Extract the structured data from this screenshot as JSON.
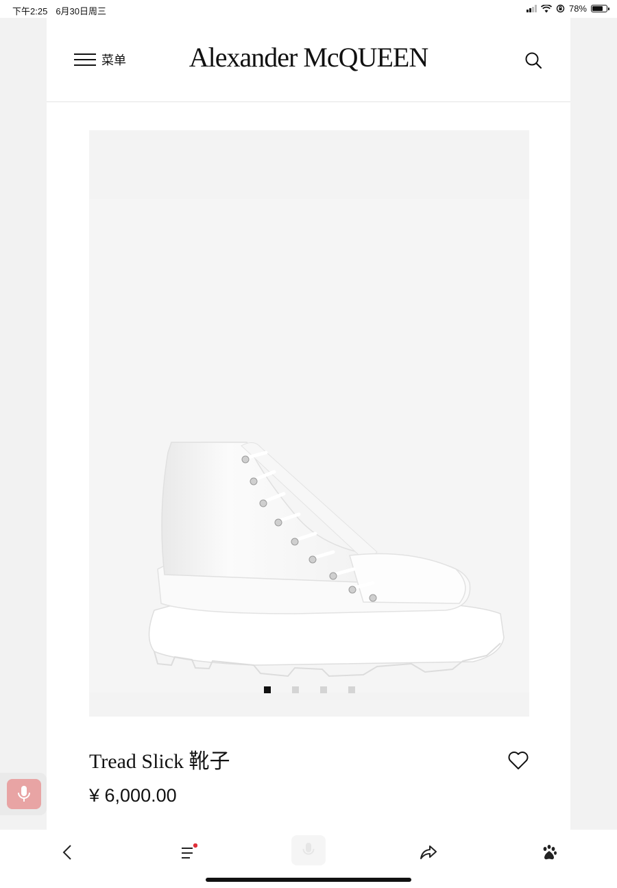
{
  "status_bar": {
    "time": "下午2:25",
    "date": "6月30日周三",
    "battery": "78%",
    "battery_level": 0.78
  },
  "header": {
    "menu_label": "菜单",
    "brand": "Alexander McQUEEN"
  },
  "product": {
    "title": "Tread Slick 靴子",
    "price": "¥ 6,000.00",
    "image_count": 4,
    "active_image": 1
  },
  "icons": {
    "menu": "hamburger-icon",
    "search": "search-icon",
    "wishlist": "heart-icon",
    "mic": "microphone-icon",
    "back": "back-chevron-icon",
    "list": "list-icon",
    "share": "share-icon",
    "baidu": "baidu-paw-icon"
  },
  "colors": {
    "accent_dot": "#e0303a",
    "mic_button": "#e8a4a4"
  }
}
